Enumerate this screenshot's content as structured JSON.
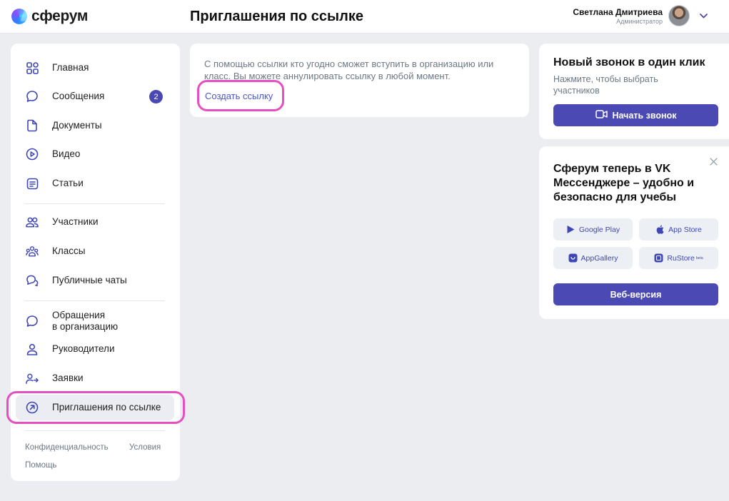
{
  "header": {
    "logo_text": "сферум",
    "page_title": "Приглашения по ссылке",
    "user_name": "Светлана Дмитриева",
    "user_role": "Администратор"
  },
  "sidebar": {
    "items": [
      {
        "label": "Главная",
        "icon": "grid-icon"
      },
      {
        "label": "Сообщения",
        "icon": "chat-bubble-icon",
        "badge": "2"
      },
      {
        "label": "Документы",
        "icon": "document-icon"
      },
      {
        "label": "Видео",
        "icon": "play-icon"
      },
      {
        "label": "Статьи",
        "icon": "article-icon"
      },
      {
        "label": "Участники",
        "icon": "users-icon"
      },
      {
        "label": "Классы",
        "icon": "group-icon"
      },
      {
        "label": "Публичные чаты",
        "icon": "public-chat-icon"
      },
      {
        "label_line1": "Обращения",
        "label_line2": "в организацию",
        "icon": "chat-bubble-icon"
      },
      {
        "label": "Руководители",
        "icon": "person-icon"
      },
      {
        "label": "Заявки",
        "icon": "person-arrow-icon"
      },
      {
        "label": "Приглашения по ссылке",
        "icon": "arrow-circle-icon",
        "active": true
      }
    ],
    "footer": {
      "privacy": "Конфиденциальность",
      "terms": "Условия",
      "help": "Помощь"
    }
  },
  "main": {
    "description": "С помощью ссылки кто угодно сможет вступить в организацию или класс. Вы можете аннулировать ссылку в любой момент.",
    "create_link": "Создать ссылку"
  },
  "call_card": {
    "title": "Новый звонок в один клик",
    "subtitle": "Нажмите, чтобы выбрать участников",
    "button": "Начать звонок"
  },
  "promo_card": {
    "title": "Сферум теперь в VK Мессенджере – удобно и безопасно для учебы",
    "stores": [
      "Google Play",
      "App Store",
      "AppGallery",
      "RuStore"
    ],
    "rustore_beta": "beta",
    "web_button": "Веб-версия"
  },
  "colors": {
    "accent": "#4b49b4",
    "highlight": "#e64fc0",
    "background": "#ebedf0"
  }
}
